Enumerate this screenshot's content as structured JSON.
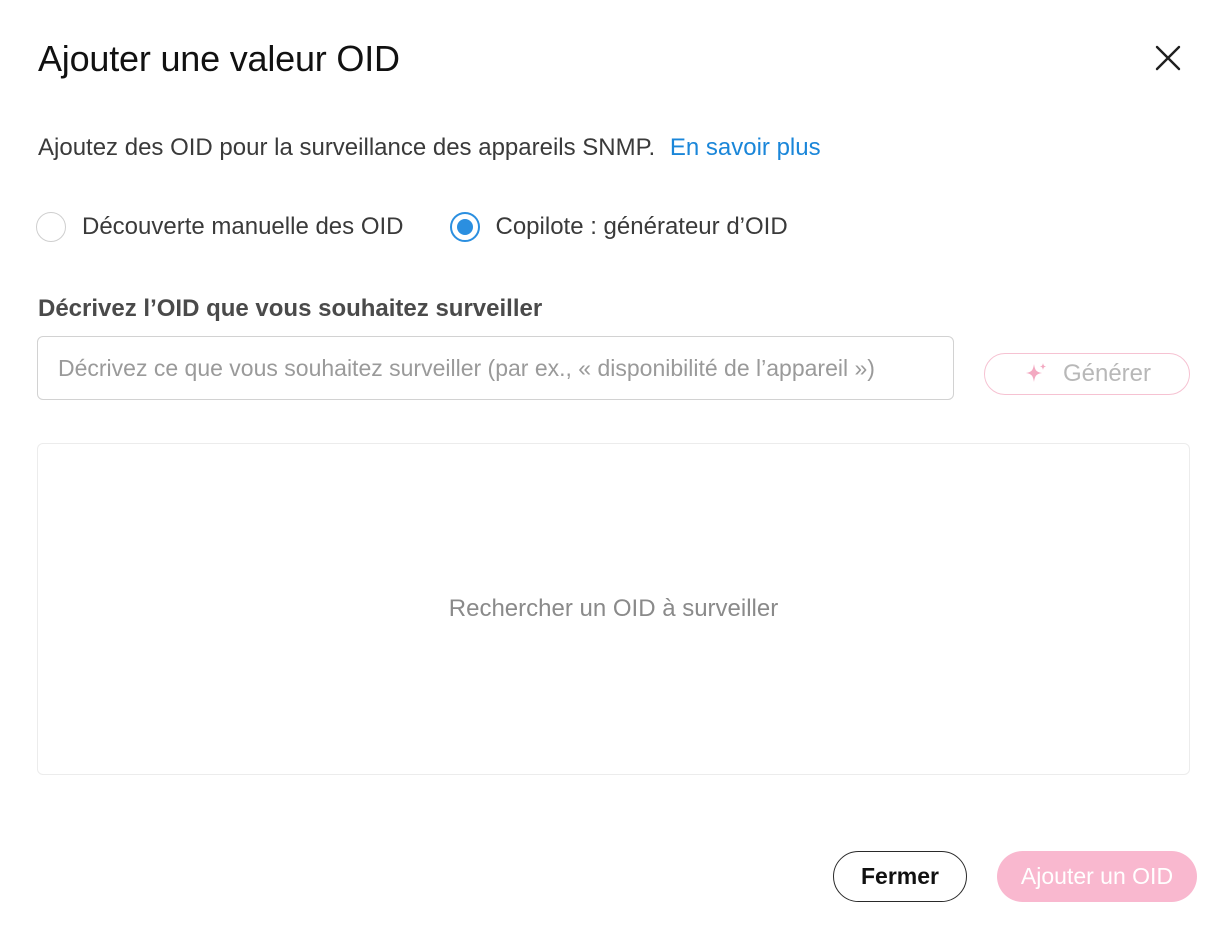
{
  "dialog": {
    "title": "Ajouter une valeur OID",
    "intro_text": "Ajoutez des OID pour la surveillance des appareils SNMP.",
    "learn_more_link": "En savoir plus"
  },
  "mode": {
    "options": [
      {
        "label": "Découverte manuelle des OID",
        "selected": false
      },
      {
        "label": "Copilote : générateur d’OID",
        "selected": true
      }
    ]
  },
  "describe": {
    "label": "Décrivez l’OID que vous souhaitez surveiller",
    "value": "",
    "placeholder": "Décrivez ce que vous souhaitez surveiller (par ex., « disponibilité de l’appareil »)",
    "generate_label": "Générer",
    "generate_icon": "sparkle-icon"
  },
  "results": {
    "empty_text": "Rechercher un OID à surveiller"
  },
  "footer": {
    "close_label": "Fermer",
    "add_label": "Ajouter un OID"
  },
  "colors": {
    "accent": "#2b8fe0",
    "link": "#1a86d9",
    "primary_disabled": "#f9b8cf",
    "generate_border": "#f6c2d2"
  }
}
